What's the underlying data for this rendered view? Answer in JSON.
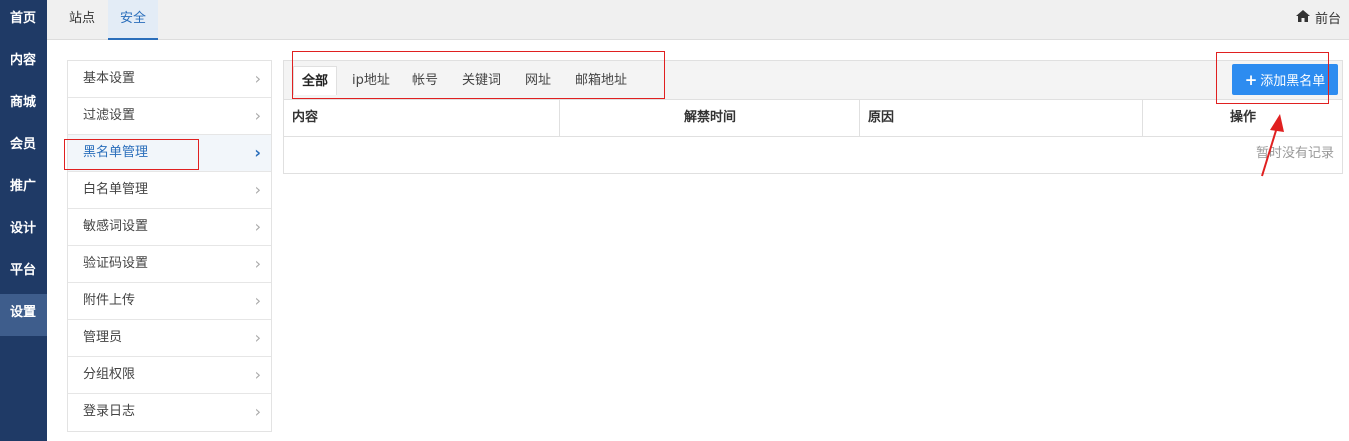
{
  "left_nav": {
    "items": [
      {
        "label": "首页"
      },
      {
        "label": "内容"
      },
      {
        "label": "商城"
      },
      {
        "label": "会员"
      },
      {
        "label": "推广"
      },
      {
        "label": "设计"
      },
      {
        "label": "平台"
      },
      {
        "label": "设置",
        "active": true
      }
    ]
  },
  "top_tabs": [
    {
      "label": "站点"
    },
    {
      "label": "安全",
      "active": true
    }
  ],
  "front_link": {
    "label": "前台",
    "icon": "home-icon"
  },
  "sub_menu": {
    "items": [
      {
        "label": "基本设置"
      },
      {
        "label": "过滤设置"
      },
      {
        "label": "黑名单管理",
        "active": true
      },
      {
        "label": "白名单管理"
      },
      {
        "label": "敏感词设置"
      },
      {
        "label": "验证码设置"
      },
      {
        "label": "附件上传"
      },
      {
        "label": "管理员"
      },
      {
        "label": "分组权限"
      },
      {
        "label": "登录日志"
      }
    ],
    "chevron": "›"
  },
  "filter_tabs": [
    {
      "label": "全部",
      "active": true
    },
    {
      "label": "ip地址"
    },
    {
      "label": "帐号"
    },
    {
      "label": "关键词"
    },
    {
      "label": "网址"
    },
    {
      "label": "邮箱地址"
    }
  ],
  "add_button": {
    "label": "添加黑名单",
    "icon": "plus-icon"
  },
  "table": {
    "columns": [
      "内容",
      "解禁时间",
      "原因",
      "操作"
    ],
    "empty_text": "暂时没有记录"
  },
  "colors": {
    "nav_bg": "#1f3a66",
    "accent": "#2a6ebb",
    "button": "#2d8cf0",
    "annotation": "#e02020"
  }
}
